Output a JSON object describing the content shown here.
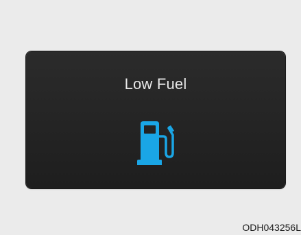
{
  "display": {
    "warning_text": "Low Fuel",
    "icon": "fuel-pump-icon",
    "icon_color": "#1aa6e6",
    "panel_color": "#232323"
  },
  "caption": {
    "code": "ODH043256L"
  },
  "colors": {
    "background": "#ebebeb",
    "text": "#e6e6e6"
  }
}
